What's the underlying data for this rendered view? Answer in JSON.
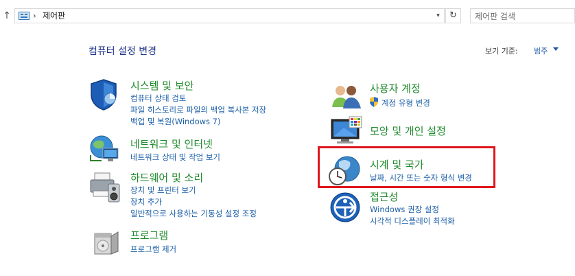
{
  "address_bar": {
    "path": "제어판",
    "separator": "›",
    "dropdown_icon": "chevron-down-icon",
    "refresh_icon": "refresh-icon"
  },
  "search": {
    "placeholder": "제어판 검색"
  },
  "page_title": "컴퓨터 설정 변경",
  "view_by": {
    "label": "보기 기준:",
    "value": "범주"
  },
  "left_categories": [
    {
      "title": "시스템 및 보안",
      "icon": "shield-icon",
      "links": [
        "컴퓨터 상태 검토",
        "파일 히스토리로 파일의 백업 복사본 저장",
        "백업 및 복원(Windows 7)"
      ]
    },
    {
      "title": "네트워크 및 인터넷",
      "icon": "network-globe-icon",
      "links": [
        "네트워크 상태 및 작업 보기"
      ]
    },
    {
      "title": "하드웨어 및 소리",
      "icon": "printer-speaker-icon",
      "links": [
        "장치 및 프린터 보기",
        "장치 추가",
        "일반적으로 사용하는 기동성 설정 조정"
      ]
    },
    {
      "title": "프로그램",
      "icon": "programs-box-icon",
      "links": [
        "프로그램 제거"
      ]
    }
  ],
  "right_categories": [
    {
      "title": "사용자 계정",
      "icon": "users-icon",
      "links": [
        "계정 유형 변경"
      ],
      "link_icon": "uac-shield-icon"
    },
    {
      "title": "모양 및 개인 설정",
      "icon": "monitor-palette-icon",
      "links": []
    },
    {
      "title": "시계 및 국가",
      "icon": "clock-globe-icon",
      "links": [
        "날짜, 시간 또는 숫자 형식 변경"
      ]
    },
    {
      "title": "접근성",
      "icon": "ease-of-access-icon",
      "links": [
        "Windows 권장 설정",
        "시각적 디스플레이 최적화"
      ]
    }
  ],
  "colors": {
    "title_green": "#1f8a2c",
    "link_blue": "#1c5fa8",
    "heading_blue": "#1e3287",
    "highlight_red": "#e0161d"
  }
}
